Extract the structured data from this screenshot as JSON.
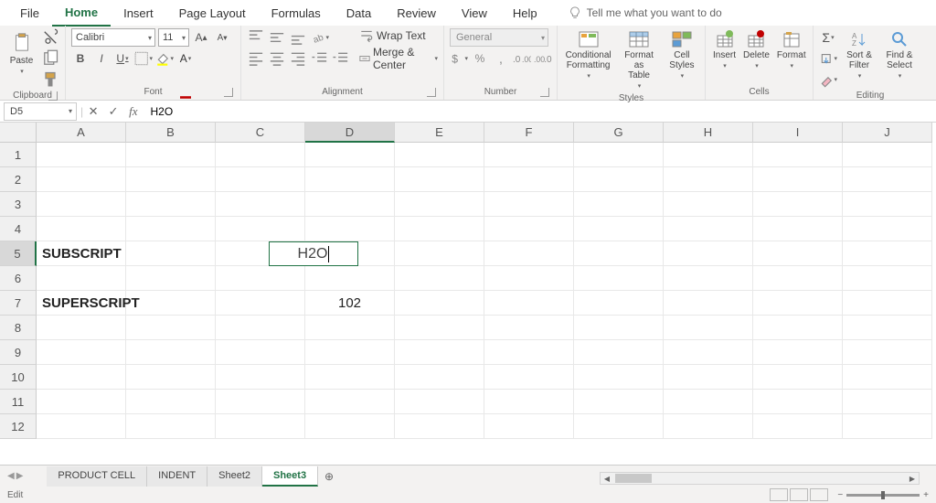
{
  "tabs": [
    "File",
    "Home",
    "Insert",
    "Page Layout",
    "Formulas",
    "Data",
    "Review",
    "View",
    "Help"
  ],
  "active_tab": "Home",
  "tell_me": "Tell me what you want to do",
  "ribbon": {
    "clipboard": {
      "label": "Clipboard",
      "paste": "Paste"
    },
    "font": {
      "label": "Font",
      "name": "Calibri",
      "size": "11"
    },
    "alignment": {
      "label": "Alignment",
      "wrap": "Wrap Text",
      "merge": "Merge & Center"
    },
    "number": {
      "label": "Number",
      "format": "General"
    },
    "styles": {
      "label": "Styles",
      "conditional": "Conditional\nFormatting",
      "format_as": "Format as\nTable",
      "cell_styles": "Cell\nStyles"
    },
    "cells": {
      "label": "Cells",
      "insert": "Insert",
      "delete": "Delete",
      "format": "Format"
    },
    "editing": {
      "label": "Editing",
      "sort": "Sort &\nFilter",
      "find": "Find &\nSelect"
    }
  },
  "name_box": "D5",
  "formula_value": "H2O",
  "columns": [
    "A",
    "B",
    "C",
    "D",
    "E",
    "F",
    "G",
    "H",
    "I",
    "J"
  ],
  "active_col": "D",
  "rows": [
    1,
    2,
    3,
    4,
    5,
    6,
    7,
    8,
    9,
    10,
    11,
    12
  ],
  "active_row": 5,
  "cell_data": {
    "A5": "SUBSCRIPT",
    "D5": "H2O",
    "A7": "SUPERSCRIPT",
    "D7": "102"
  },
  "sheets": [
    "PRODUCT CELL",
    "INDENT",
    "Sheet2",
    "Sheet3"
  ],
  "active_sheet": "Sheet3",
  "status": "Edit"
}
